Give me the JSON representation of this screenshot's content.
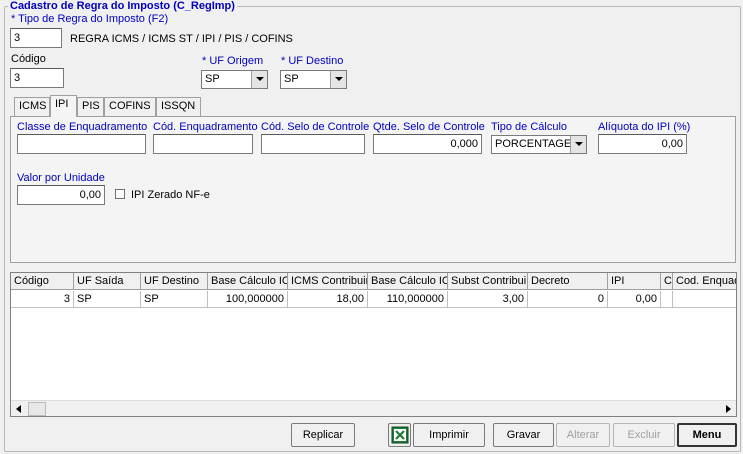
{
  "window": {
    "title": "Cadastro de Regra do Imposto (C_RegImp)"
  },
  "tipo_regra": {
    "label": "* Tipo de Regra do Imposto (F2)",
    "value": "3",
    "description": "REGRA ICMS / ICMS ST / IPI / PIS / COFINS"
  },
  "codigo": {
    "label": "Código",
    "value": "3"
  },
  "uf_origem": {
    "label": "* UF Origem",
    "value": "SP"
  },
  "uf_destino": {
    "label": "* UF Destino",
    "value": "SP"
  },
  "tabs": [
    {
      "label": "ICMS",
      "active": false
    },
    {
      "label": "IPI",
      "active": true
    },
    {
      "label": "PIS",
      "active": false
    },
    {
      "label": "COFINS",
      "active": false
    },
    {
      "label": "ISSQN",
      "active": false
    }
  ],
  "ipi": {
    "classe_enquadramento": {
      "label": "Classe de Enquadramento",
      "value": ""
    },
    "cod_enquadramento": {
      "label": "Cód. Enquadramento",
      "value": ""
    },
    "cod_selo": {
      "label": "Cód. Selo de Controle",
      "value": ""
    },
    "qtde_selo": {
      "label": "Qtde. Selo de Controle",
      "value": "0,000"
    },
    "tipo_calculo": {
      "label": "Tipo de Cálculo",
      "value": "PORCENTAGEM"
    },
    "aliquota": {
      "label": "Alíquota do IPI (%)",
      "value": "0,00"
    },
    "valor_unidade": {
      "label": "Valor por Unidade",
      "value": "0,00"
    },
    "ipi_zerado": {
      "label": "IPI Zerado NF-e",
      "checked": false
    }
  },
  "grid": {
    "columns": [
      "Código",
      "UF Saída",
      "UF Destino",
      "Base Cálculo IC",
      "ICMS Contribuin",
      "Base Cálculo IC",
      "Subst Contribui",
      "Decreto",
      "IPI",
      "C",
      "Cod. Enquad"
    ],
    "rows": [
      [
        "3",
        "SP",
        "SP",
        "100,000000",
        "18,00",
        "110,000000",
        "3,00",
        "0",
        "0,00",
        "",
        ""
      ]
    ]
  },
  "buttons": {
    "replicar": "Replicar",
    "imprimir": "Imprimir",
    "gravar": "Gravar",
    "alterar": "Alterar",
    "excluir": "Excluir",
    "menu": "Menu"
  },
  "colors": {
    "accent_label": "#0000c0",
    "excel_green": "#1f7a34"
  }
}
